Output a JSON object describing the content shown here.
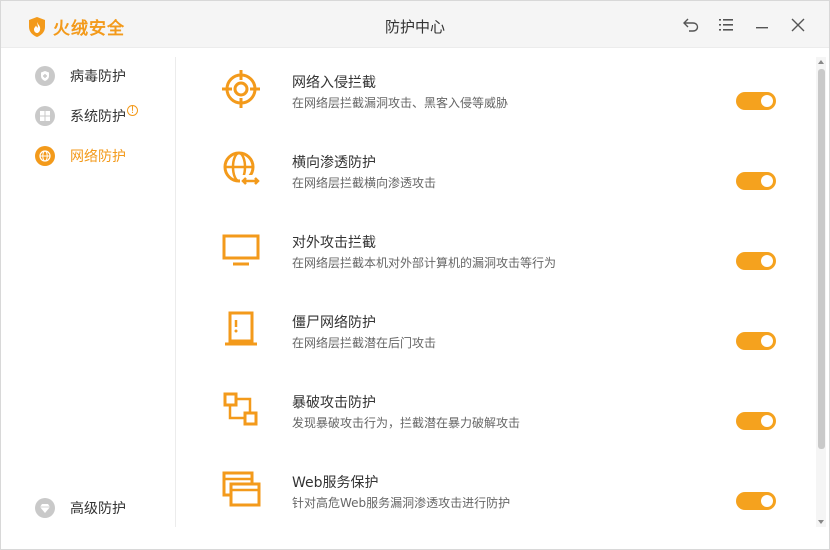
{
  "app": {
    "logo_text": "火绒安全",
    "title": "防护中心"
  },
  "window_controls": [
    "back-icon",
    "menu-icon",
    "minimize-icon",
    "close-icon"
  ],
  "sidebar": {
    "items": [
      {
        "label": "病毒防护",
        "icon": "virus-shield-icon",
        "active": false,
        "badge": ""
      },
      {
        "label": "系统防护",
        "icon": "windows-icon",
        "active": false,
        "badge": "!"
      },
      {
        "label": "网络防护",
        "icon": "globe-icon",
        "active": true,
        "badge": ""
      }
    ],
    "bottom_item": {
      "label": "高级防护",
      "icon": "diamond-icon"
    }
  },
  "protections": [
    {
      "title": "网络入侵拦截",
      "desc": "在网络层拦截漏洞攻击、黑客入侵等威胁",
      "icon": "crosshair-icon",
      "enabled": true
    },
    {
      "title": "横向渗透防护",
      "desc": "在网络层拦截横向渗透攻击",
      "icon": "globe-arrows-icon",
      "enabled": true
    },
    {
      "title": "对外攻击拦截",
      "desc": "在网络层拦截本机对外部计算机的漏洞攻击等行为",
      "icon": "monitor-icon",
      "enabled": true
    },
    {
      "title": "僵尸网络防护",
      "desc": "在网络层拦截潜在后门攻击",
      "icon": "door-icon",
      "enabled": true
    },
    {
      "title": "暴破攻击防护",
      "desc": "发现暴破攻击行为，拦截潜在暴力破解攻击",
      "icon": "nodes-icon",
      "enabled": true
    },
    {
      "title": "Web服务保护",
      "desc": "针对高危Web服务漏洞渗透攻击进行防护",
      "icon": "browser-windows-icon",
      "enabled": true
    }
  ],
  "colors": {
    "accent": "#f39a1b",
    "toggle_on": "#f5a21e",
    "inactive_icon": "#c9c9c9",
    "titlebar_bg": "#f5f5f5"
  }
}
